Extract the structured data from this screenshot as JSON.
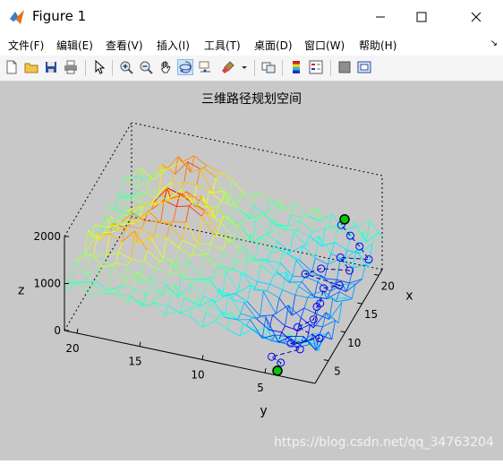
{
  "window": {
    "title": "Figure 1",
    "minimize_label": "—",
    "maximize_label": "☐",
    "close_label": "✕"
  },
  "menu": [
    {
      "label": "文件(F)"
    },
    {
      "label": "编辑(E)"
    },
    {
      "label": "查看(V)"
    },
    {
      "label": "插入(I)"
    },
    {
      "label": "工具(T)"
    },
    {
      "label": "桌面(D)"
    },
    {
      "label": "窗口(W)"
    },
    {
      "label": "帮助(H)"
    }
  ],
  "menu_overflow": "↘",
  "toolbar": [
    {
      "icon": "new-figure-icon"
    },
    {
      "icon": "open-file-icon"
    },
    {
      "icon": "save-icon"
    },
    {
      "icon": "print-icon"
    },
    {
      "icon": "edit-plot-icon"
    },
    {
      "icon": "zoom-in-icon"
    },
    {
      "icon": "zoom-out-icon"
    },
    {
      "icon": "pan-icon"
    },
    {
      "icon": "rotate-3d-icon",
      "active": true
    },
    {
      "icon": "data-cursor-icon"
    },
    {
      "icon": "brush-icon"
    },
    {
      "icon": "link-plot-icon"
    },
    {
      "icon": "colorbar-icon"
    },
    {
      "icon": "legend-icon"
    },
    {
      "icon": "hide-plot-tools-icon"
    },
    {
      "icon": "show-plot-tools-icon"
    }
  ],
  "colors": {
    "canvas_bg": "#c8c8c8",
    "path_line": "#0000aa",
    "waypoint": "#0000ff",
    "endpoint_fill": "#00cc00"
  },
  "chart_data": {
    "type": "surface",
    "title": "三维路径规划空间",
    "xlabel": "x",
    "ylabel": "y",
    "zlabel": "z",
    "x_ticks": [
      "5",
      "10",
      "15",
      "20"
    ],
    "y_ticks": [
      "20",
      "15",
      "10",
      "5"
    ],
    "z_ticks": [
      "0",
      "1000",
      "2000"
    ],
    "xlim": [
      1,
      21
    ],
    "ylim": [
      1,
      21
    ],
    "zlim": [
      0,
      2000
    ],
    "grid": true,
    "colormap": "jet",
    "path_nodes": [
      {
        "x": 1,
        "y": 4,
        "z": 100
      },
      {
        "x": 2,
        "y": 4,
        "z": 150
      },
      {
        "x": 3,
        "y": 5,
        "z": 100
      },
      {
        "x": 4,
        "y": 3,
        "z": 250
      },
      {
        "x": 5,
        "y": 4,
        "z": 200
      },
      {
        "x": 6,
        "y": 2,
        "z": 300
      },
      {
        "x": 7,
        "y": 4,
        "z": 300
      },
      {
        "x": 8,
        "y": 3,
        "z": 400
      },
      {
        "x": 9,
        "y": 3,
        "z": 550
      },
      {
        "x": 10,
        "y": 3,
        "z": 500
      },
      {
        "x": 11,
        "y": 3,
        "z": 700
      },
      {
        "x": 12,
        "y": 2,
        "z": 700
      },
      {
        "x": 13,
        "y": 5,
        "z": 650
      },
      {
        "x": 14,
        "y": 4,
        "z": 700
      },
      {
        "x": 15,
        "y": 2,
        "z": 650
      },
      {
        "x": 16,
        "y": 3,
        "z": 750
      },
      {
        "x": 17,
        "y": 1,
        "z": 700
      },
      {
        "x": 18,
        "y": 2,
        "z": 800
      },
      {
        "x": 19,
        "y": 3,
        "z": 850
      },
      {
        "x": 20,
        "y": 4,
        "z": 900
      },
      {
        "x": 21,
        "y": 4,
        "z": 900
      }
    ],
    "start_point": {
      "x": 1,
      "y": 4,
      "z": 100
    },
    "end_point": {
      "x": 21,
      "y": 4,
      "z": 900
    }
  },
  "watermark": "https://blog.csdn.net/qq_34763204"
}
